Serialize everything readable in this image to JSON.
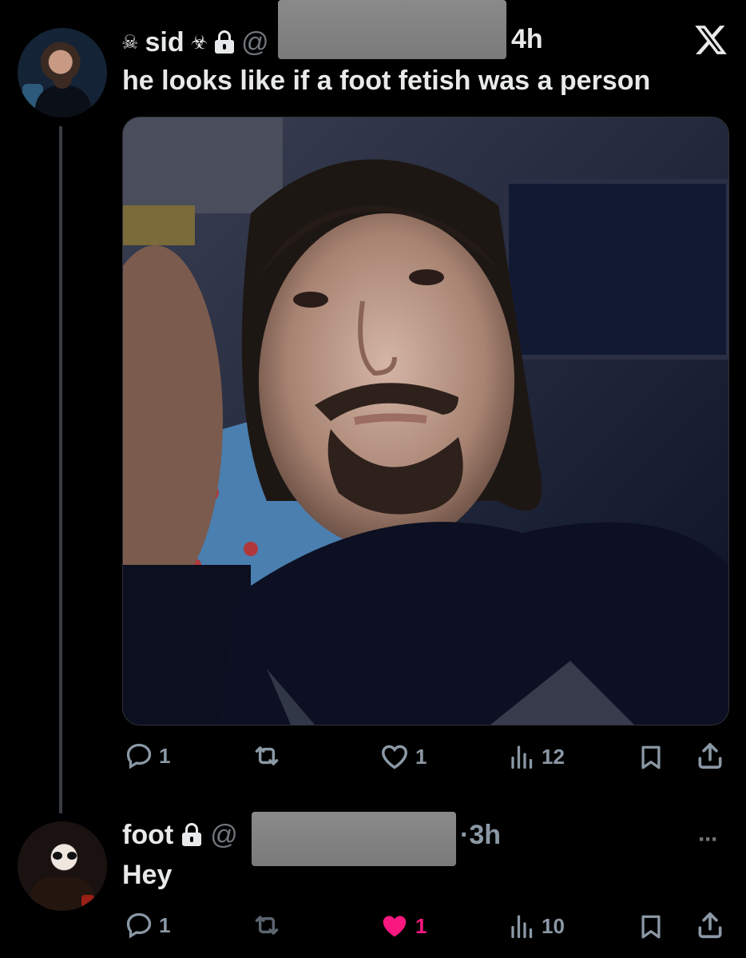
{
  "tweet1": {
    "display_name": "sid",
    "name_prefix_glyph": "☠",
    "name_suffix_glyph": "☣",
    "handle_prefix": "@",
    "time": "4h",
    "text": "he looks like if a foot fetish was a person",
    "stats": {
      "replies": "1",
      "likes": "1",
      "views": "12"
    }
  },
  "tweet2": {
    "display_name": "foot",
    "handle_prefix": "@",
    "time": "·3h",
    "more": "···",
    "text": "Hey",
    "stats": {
      "replies": "1",
      "likes": "1",
      "views": "10"
    },
    "liked": true
  },
  "colors": {
    "background": "#000000",
    "text": "#e7e9ea",
    "secondary": "#8b98a5",
    "like_active": "#f91880",
    "redaction": "#808080"
  },
  "icons": {
    "app_logo": "x-logo-icon",
    "lock": "lock-icon",
    "reply": "reply-icon",
    "retweet": "retweet-icon",
    "like": "heart-icon",
    "views": "views-icon",
    "bookmark": "bookmark-icon",
    "share": "share-icon"
  }
}
